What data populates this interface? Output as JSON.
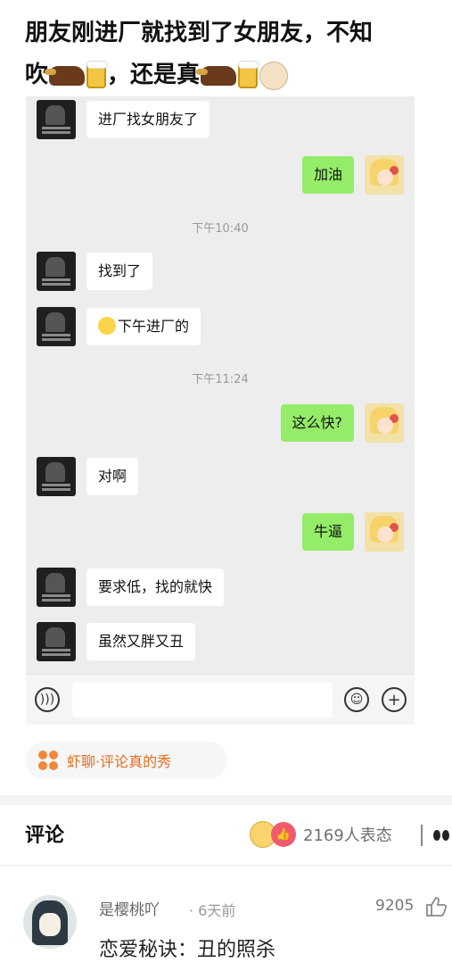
{
  "post": {
    "title_line1": "朋友刚进厂就找到了女朋友，不知",
    "title_line2_a": "吹",
    "title_line2_b": "，还是真"
  },
  "chat": {
    "messages": [
      {
        "side": "left",
        "text": "进厂找女朋友了"
      },
      {
        "side": "right",
        "text": "加油"
      },
      {
        "side": "left",
        "text": "找到了"
      },
      {
        "side": "left",
        "text": "下午进厂的"
      },
      {
        "side": "right",
        "text": "这么快?"
      },
      {
        "side": "left",
        "text": "对啊"
      },
      {
        "side": "right",
        "text": "牛逼"
      },
      {
        "side": "left",
        "text": "要求低，找的就快"
      },
      {
        "side": "left",
        "text": "虽然又胖又丑"
      }
    ],
    "timestamps": [
      "下午10:40",
      "下午11:24"
    ]
  },
  "input_bar": {
    "voice_icon": "voice-icon",
    "emoji_icon": "emoji-icon",
    "plus_icon": "plus-icon"
  },
  "tag": {
    "label": "虾聊·评论真的秀",
    "color": "#e46d1e"
  },
  "comments": {
    "header": "评论",
    "reaction_count": "2169人表态",
    "items": [
      {
        "user": "是樱桃吖",
        "time": "· 6天前",
        "likes": "9205",
        "text": "恋爱秘诀：丑的照杀"
      }
    ]
  },
  "colors": {
    "bubble_right": "#95ec69",
    "chat_bg": "#ededed"
  }
}
